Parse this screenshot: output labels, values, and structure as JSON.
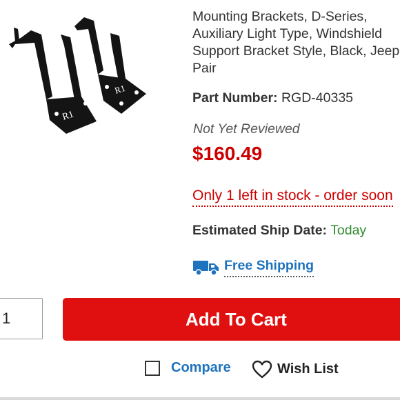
{
  "product": {
    "title": "Mounting Brackets, D-Series,\nAuxiliary Light Type, Windshield\nSupport Bracket Style, Black, Jeep\nPair",
    "part_number_label": "Part Number:",
    "part_number": "RGD-40335",
    "reviews": "Not Yet Reviewed",
    "price": "$160.49",
    "stock": "Only 1 left in stock - order soon",
    "ship_date_label": "Estimated Ship Date:",
    "ship_date": "Today",
    "free_shipping": "Free Shipping"
  },
  "purchase": {
    "quantity": "1",
    "add_to_cart": "Add To Cart",
    "compare": "Compare",
    "wish_list": "Wish List"
  },
  "colors": {
    "price_red": "#cc0000",
    "button_red": "#e01010",
    "link_blue": "#1e73be",
    "ship_green": "#2e8b2e"
  },
  "icons": {
    "shipping": "truck-icon",
    "compare": "checkbox-icon",
    "wish_list": "heart-icon"
  }
}
